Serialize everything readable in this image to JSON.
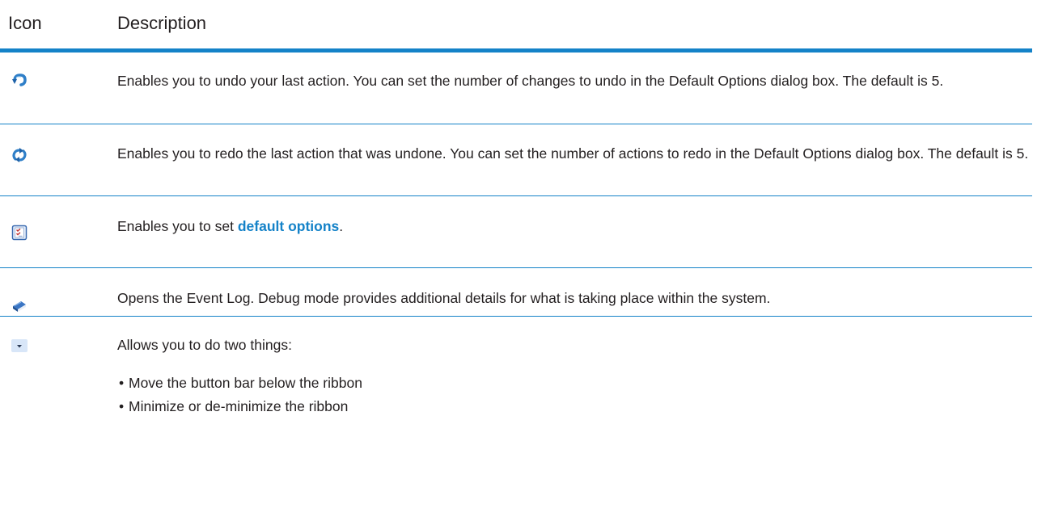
{
  "header": {
    "icon_col": "Icon",
    "desc_col": "Description"
  },
  "rows": [
    {
      "icon": "undo-icon",
      "text": "Enables you to undo your last action. You can set the number of changes to undo in the Default Options dialog box. The default is 5."
    },
    {
      "icon": "redo-icon",
      "text": "Enables you to redo the last action that was undone. You can set the number of actions to redo in the Default Options dialog box. The default is 5."
    },
    {
      "icon": "options-checklist-icon",
      "text_before": "Enables you to set ",
      "link": "default options",
      "text_after": "."
    },
    {
      "icon": "event-log-icon",
      "text": "Opens the Event Log. Debug mode provides additional details for what is taking place within the system."
    },
    {
      "icon": "dropdown-arrow-icon",
      "text": "Allows you to do two things:",
      "bullets": [
        "Move the button bar below the ribbon",
        "Minimize or de-minimize the ribbon"
      ]
    }
  ],
  "colors": {
    "accent": "#1482c8",
    "text": "#231f20"
  }
}
